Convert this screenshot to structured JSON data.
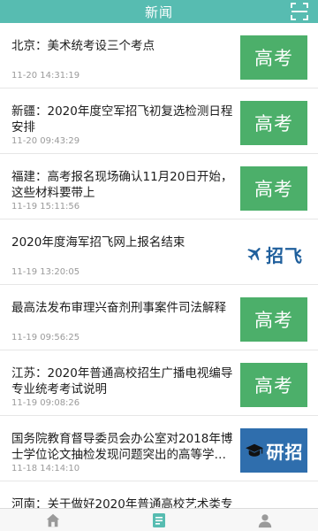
{
  "header": {
    "title": "新闻"
  },
  "news": [
    {
      "title": "北京：美术统考设三个考点",
      "time": "11-20 14:31:19",
      "tag": "高考",
      "tag_style": "gaokao"
    },
    {
      "title": "新疆：2020年度空军招飞初复选检测日程安排",
      "time": "11-20 09:43:29",
      "tag": "高考",
      "tag_style": "gaokao"
    },
    {
      "title": "福建：高考报名现场确认11月20日开始，这些材料要带上",
      "time": "11-19 15:11:56",
      "tag": "高考",
      "tag_style": "gaokao"
    },
    {
      "title": "2020年度海军招飞网上报名结束",
      "time": "11-19 13:20:05",
      "tag": "招飞",
      "tag_style": "zhaofei"
    },
    {
      "title": "最高法发布审理兴奋剂刑事案件司法解释",
      "time": "11-19 09:56:25",
      "tag": "高考",
      "tag_style": "gaokao"
    },
    {
      "title": "江苏：2020年普通高校招生广播电视编导专业统考考试说明",
      "time": "11-19 09:08:26",
      "tag": "高考",
      "tag_style": "gaokao"
    },
    {
      "title": "国务院教育督导委员会办公室对2018年博士学位论文抽检发现问题突出的高等学…",
      "time": "11-18 14:14:10",
      "tag": "研招",
      "tag_style": "yanzhao"
    },
    {
      "title": "河南：关于做好2020年普通高校艺术类专",
      "time": "",
      "tag": "",
      "tag_style": ""
    }
  ],
  "colors": {
    "header": "#57bcb1",
    "gaokao_tag": "#4caf6a",
    "yanzhao_tag": "#2f6ead",
    "zhaofei_text": "#1f5f9c",
    "tab_active": "#57bcb1"
  },
  "tabs": [
    {
      "icon": "home-icon",
      "active": false
    },
    {
      "icon": "news-icon",
      "active": true
    },
    {
      "icon": "user-icon",
      "active": false
    }
  ]
}
